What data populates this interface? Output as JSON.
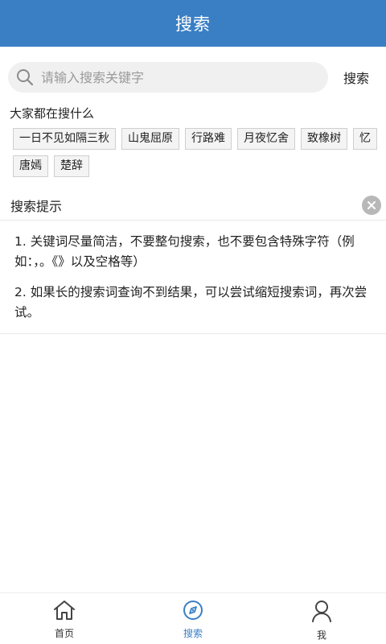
{
  "header": {
    "title": "搜索"
  },
  "search": {
    "placeholder": "请输入搜索关键字",
    "value": "",
    "button_label": "搜索"
  },
  "hot": {
    "title": "大家都在搜什么",
    "tags": [
      "一日不见如隔三秋",
      "山鬼屈原",
      "行路难",
      "月夜忆舍",
      "致橡树",
      "忆",
      "唐嫣",
      "楚辞"
    ]
  },
  "tips": {
    "title": "搜索提示",
    "items": [
      "1. 关键词尽量简洁，不要整句搜索，也不要包含特殊字符（例如：，。《》以及空格等）",
      "2. 如果长的搜索词查询不到结果，可以尝试缩短搜索词，再次尝试。"
    ]
  },
  "tabbar": {
    "items": [
      {
        "label": "首页",
        "icon": "home-icon",
        "active": false
      },
      {
        "label": "搜索",
        "icon": "compass-icon",
        "active": true
      },
      {
        "label": "我",
        "icon": "person-icon",
        "active": false
      }
    ]
  },
  "colors": {
    "primary": "#3a7fc4",
    "search_bg": "#f0f0f0",
    "tag_border": "#cfcfcf"
  }
}
